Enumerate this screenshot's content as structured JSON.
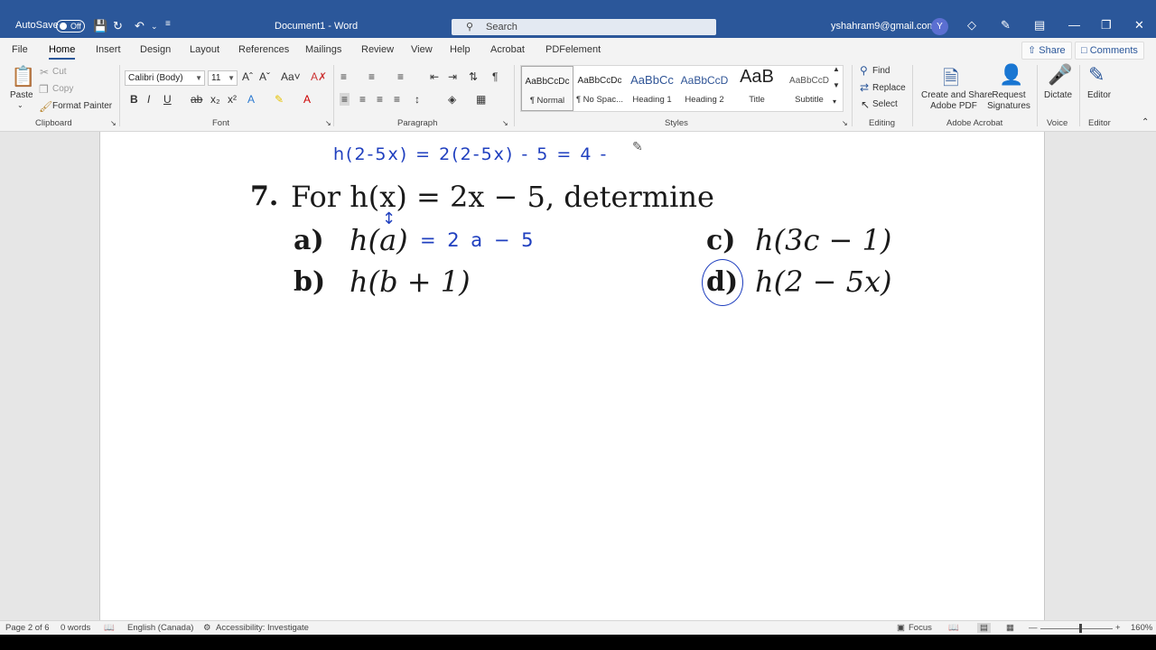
{
  "titlebar": {
    "autosave_label": "AutoSave",
    "autosave_state": "Off",
    "doc_title": "Document1  -  Word",
    "search_placeholder": "Search",
    "account_email": "yshahram9@gmail.com",
    "avatar_initial": "Y"
  },
  "tabs": [
    "File",
    "Home",
    "Insert",
    "Design",
    "Layout",
    "References",
    "Mailings",
    "Review",
    "View",
    "Help",
    "Acrobat",
    "PDFelement"
  ],
  "share_label": "Share",
  "comments_label": "Comments",
  "clipboard": {
    "paste": "Paste",
    "cut": "Cut",
    "copy": "Copy",
    "format_painter": "Format Painter",
    "label": "Clipboard"
  },
  "font": {
    "family": "Calibri (Body)",
    "size": "11",
    "label": "Font"
  },
  "paragraph": {
    "label": "Paragraph"
  },
  "styles": {
    "label": "Styles",
    "items": [
      {
        "preview": "AaBbCcDc",
        "name": "¶ Normal"
      },
      {
        "preview": "AaBbCcDc",
        "name": "¶ No Spac..."
      },
      {
        "preview": "AaBbCc",
        "name": "Heading 1"
      },
      {
        "preview": "AaBbCcD",
        "name": "Heading 2"
      },
      {
        "preview": "AaB",
        "name": "Title"
      },
      {
        "preview": "AaBbCcD",
        "name": "Subtitle"
      }
    ]
  },
  "editing": {
    "find": "Find",
    "replace": "Replace",
    "select": "Select",
    "label": "Editing"
  },
  "acrobat": {
    "create_share": "Create and Share",
    "adobe_pdf": "Adobe PDF",
    "request": "Request",
    "signatures": "Signatures",
    "label": "Adobe Acrobat"
  },
  "voice": {
    "dictate": "Dictate",
    "label": "Voice"
  },
  "editor": {
    "editor": "Editor",
    "label": "Editor"
  },
  "document": {
    "ink_top": "h(2-5x) = 2(2-5x) - 5 = 4 -",
    "problem_number": "7.",
    "problem_text": "For h(x) = 2x − 5, determine",
    "a_label": "a)",
    "a_expr": "h(a)",
    "a_ink": "= 2 a − 5",
    "b_label": "b)",
    "b_expr": "h(b + 1)",
    "c_label": "c)",
    "c_expr": "h(3c − 1)",
    "d_label": "d)",
    "d_expr": "h(2 − 5x)"
  },
  "statusbar": {
    "page": "Page 2 of 6",
    "words": "0 words",
    "language": "English (Canada)",
    "accessibility": "Accessibility: Investigate",
    "focus": "Focus",
    "zoom": "160%"
  }
}
